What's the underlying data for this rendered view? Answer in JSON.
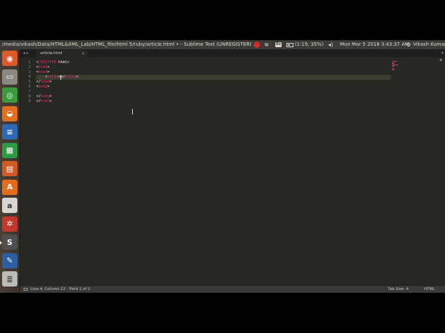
{
  "top_panel": {
    "window_title": "/media/vikash/Data/HTML&XML_Lab/HTML_file/html 5/ruby/article.html • - Sublime Text (UNREGISTERED)",
    "keyboard_layout": "En",
    "battery": "(1:19, 35%)",
    "clock": "Mon Mar  5 2018 3:43:37 AM",
    "user": "Vikash Kumar",
    "icons": {
      "record": "record-indicator-icon",
      "network": "wifi-icon",
      "battery": "battery-icon",
      "volume": "volume-icon",
      "settings": "gear-icon"
    },
    "glyphs": {
      "wifi": "≋",
      "volume": "◂)",
      "gear": "⚙"
    }
  },
  "launcher": {
    "items": [
      {
        "name": "ubuntu-dash",
        "glyph": "◉",
        "color": "#dd5a2a"
      },
      {
        "name": "files",
        "glyph": "▭",
        "color": "#8a8a82"
      },
      {
        "name": "chrome",
        "glyph": "◎",
        "color": "#3a9a3c"
      },
      {
        "name": "firefox",
        "glyph": "◒",
        "color": "#e0701f"
      },
      {
        "name": "libreoffice-writer",
        "glyph": "≡",
        "color": "#2f69b5"
      },
      {
        "name": "libreoffice-calc",
        "glyph": "▦",
        "color": "#2f9a45"
      },
      {
        "name": "libreoffice-impress",
        "glyph": "▤",
        "color": "#d25a24"
      },
      {
        "name": "software-center",
        "glyph": "A",
        "color": "#e66c1c"
      },
      {
        "name": "amazon",
        "glyph": "a",
        "color": "#d8d6d0"
      },
      {
        "name": "system-settings",
        "glyph": "✲",
        "color": "#c2382b"
      },
      {
        "name": "sublime-text",
        "glyph": "S",
        "color": "#4f4f4f"
      },
      {
        "name": "screenshot-tool",
        "glyph": "✎",
        "color": "#2c5f9e"
      },
      {
        "name": "disks",
        "glyph": "≣",
        "color": "#bdbdb8"
      }
    ]
  },
  "editor": {
    "tab_nav": "◂ ▸",
    "tab": {
      "label": "article.html",
      "close": "×"
    },
    "tab_dropdown": "▾",
    "scroll_up": "▲",
    "lines": [
      {
        "num": "1",
        "tokens": [
          [
            "punc",
            "<"
          ],
          [
            "tag",
            "!DOCTYPE"
          ],
          [
            "text",
            " html"
          ],
          [
            "punc",
            ">"
          ]
        ]
      },
      {
        "num": "2",
        "tokens": [
          [
            "punc",
            "<"
          ],
          [
            "tag",
            "html"
          ],
          [
            "punc",
            ">"
          ]
        ]
      },
      {
        "num": "3",
        "tokens": [
          [
            "punc",
            "<"
          ],
          [
            "tag",
            "head"
          ],
          [
            "punc",
            ">"
          ]
        ]
      },
      {
        "num": "4",
        "tokens": [
          [
            "text",
            "    "
          ],
          [
            "punc",
            "<"
          ],
          [
            "tag",
            "title"
          ],
          [
            "punc",
            "></"
          ],
          [
            "tag",
            "title"
          ],
          [
            "punc",
            ">"
          ]
        ]
      },
      {
        "num": "5",
        "tokens": [
          [
            "punc",
            "</"
          ],
          [
            "tag",
            "head"
          ],
          [
            "punc",
            ">"
          ]
        ]
      },
      {
        "num": "6",
        "tokens": [
          [
            "punc",
            "<"
          ],
          [
            "tag",
            "body"
          ],
          [
            "punc",
            ">"
          ]
        ]
      },
      {
        "num": "7",
        "tokens": []
      },
      {
        "num": "8",
        "tokens": [
          [
            "punc",
            "</"
          ],
          [
            "tag",
            "body"
          ],
          [
            "punc",
            ">"
          ]
        ]
      },
      {
        "num": "9",
        "tokens": [
          [
            "punc",
            "</"
          ],
          [
            "tag",
            "html"
          ],
          [
            "punc",
            ">"
          ]
        ]
      }
    ],
    "current_line_index": 3,
    "caret_column": 11
  },
  "status_bar": {
    "position": "Line 4, Column 12 - Field 1 of 2",
    "tab_size": "Tab Size: 4",
    "syntax": "HTML"
  },
  "colors": {
    "editor_bg": "#272822",
    "tag": "#f92672",
    "text": "#f8f8f2",
    "line_number": "#8f908a"
  }
}
